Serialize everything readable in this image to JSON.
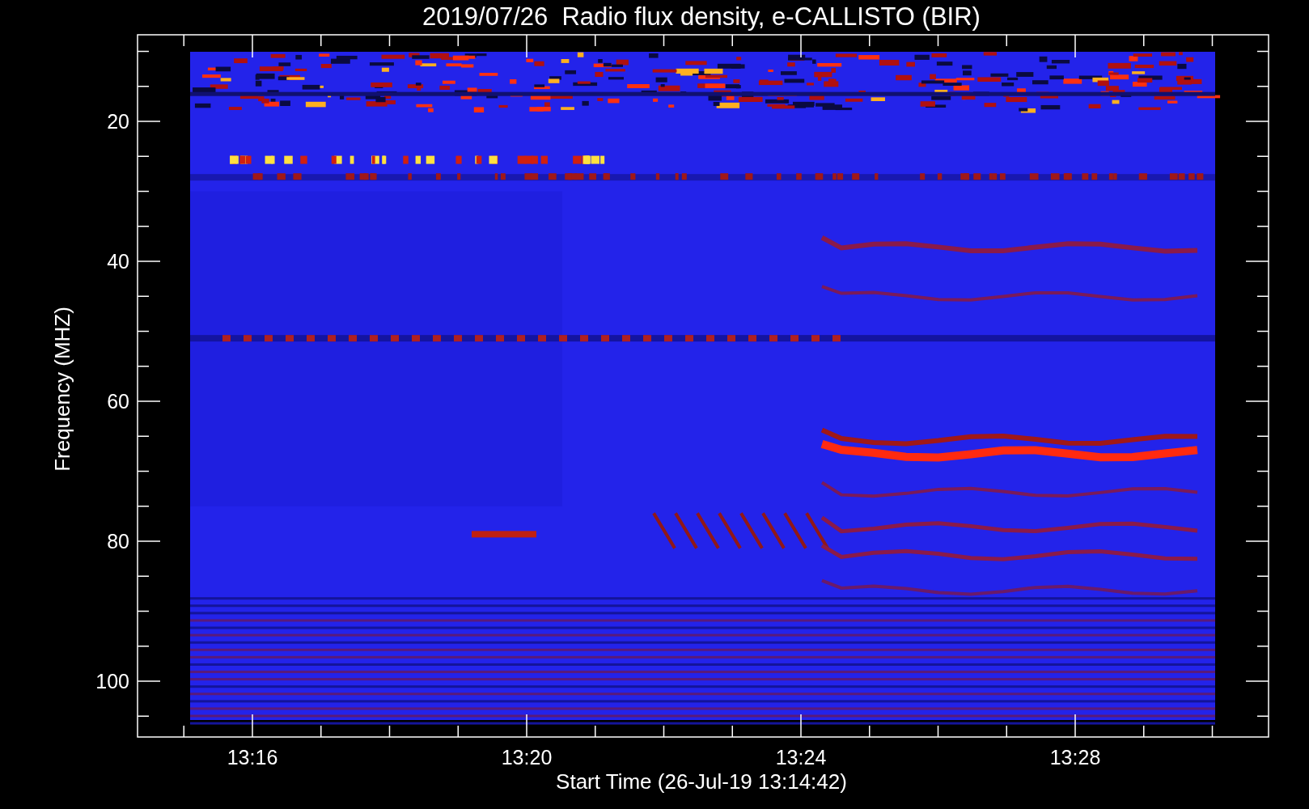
{
  "title": "2019/07/26  Radio flux density, e-CALLISTO (BIR)",
  "plot": {
    "xlabel": "Start Time (26-Jul-19 13:14:42)",
    "ylabel": "Frequency (MHZ)",
    "xticks": [
      "13:16",
      "13:20",
      "13:24",
      "13:28"
    ],
    "yticks": [
      "20",
      "40",
      "60",
      "80",
      "100"
    ]
  }
}
